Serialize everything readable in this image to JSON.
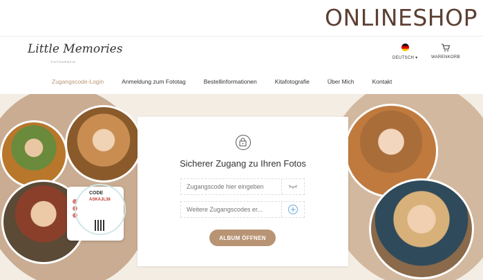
{
  "banner": {
    "title": "ONLINESHOP"
  },
  "header": {
    "logo_text": "Little Memories",
    "logo_sub": "FOTOGRAFIE",
    "language_label": "DEUTSCH ▾",
    "cart_label": "WARENKORB"
  },
  "nav": {
    "items": [
      {
        "label": "Zugangscode-Login",
        "active": true
      },
      {
        "label": "Anmeldung zum Fototag",
        "active": false
      },
      {
        "label": "Bestellinformationen",
        "active": false
      },
      {
        "label": "Kitafotografie",
        "active": false
      },
      {
        "label": "Über Mich",
        "active": false
      },
      {
        "label": "Kontakt",
        "active": false
      }
    ]
  },
  "login": {
    "title": "Sicherer Zugang zu Ihren Fotos",
    "code_placeholder": "Zugangscode hier eingeben",
    "more_codes_placeholder": "Weitere Zugangscodes er...",
    "submit_label": "ALBUM ÖFFNEN"
  },
  "code_card": {
    "label": "CODE",
    "value": "ASKAJL38"
  },
  "colors": {
    "accent": "#b89474",
    "blob": "#c9ac92",
    "background": "#f3ede4",
    "brand_text": "#5c4033"
  },
  "icons": [
    "flag-de-icon",
    "cart-icon",
    "lock-icon",
    "eye-closed-icon",
    "plus-circle-icon"
  ]
}
